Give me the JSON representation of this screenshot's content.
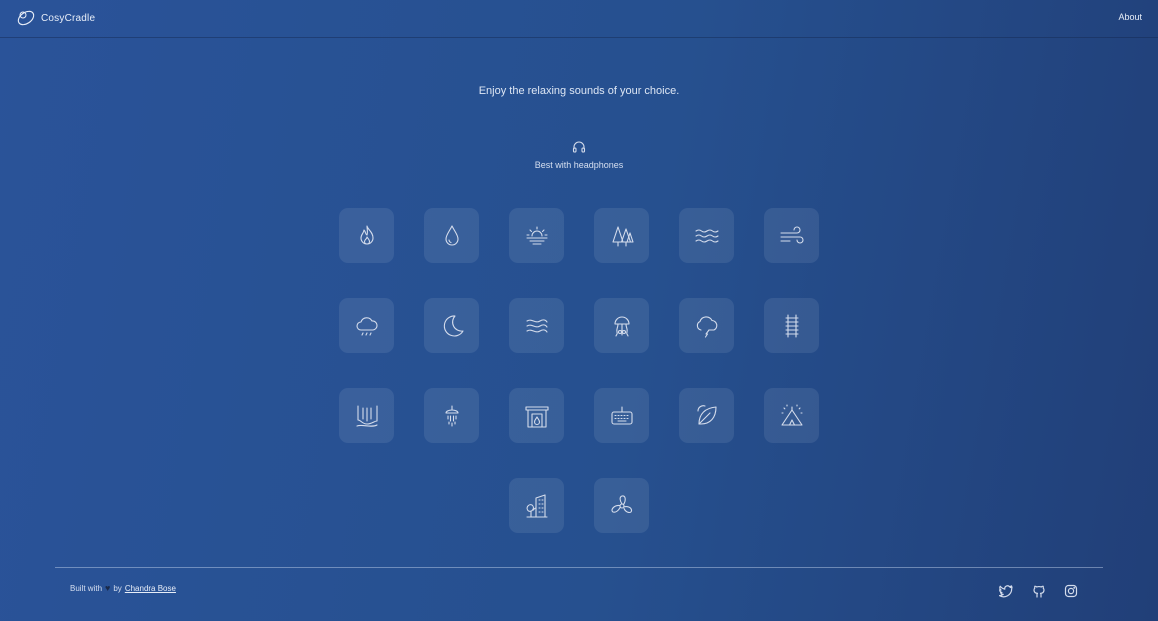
{
  "header": {
    "brand": "CosyCradle",
    "about_link": "About"
  },
  "main": {
    "tagline": "Enjoy the relaxing sounds of your choice.",
    "headphones_note": "Best with headphones"
  },
  "sounds": [
    {
      "icon": "fire-icon"
    },
    {
      "icon": "water-drop-icon"
    },
    {
      "icon": "sunset-icon"
    },
    {
      "icon": "forest-icon"
    },
    {
      "icon": "waves-icon"
    },
    {
      "icon": "wind-icon"
    },
    {
      "icon": "rain-cloud-icon"
    },
    {
      "icon": "moon-icon"
    },
    {
      "icon": "stream-icon"
    },
    {
      "icon": "jellyfish-icon"
    },
    {
      "icon": "thunder-cloud-icon"
    },
    {
      "icon": "train-track-icon"
    },
    {
      "icon": "waterfall-icon"
    },
    {
      "icon": "shower-icon"
    },
    {
      "icon": "fireplace-icon"
    },
    {
      "icon": "keyboard-icon"
    },
    {
      "icon": "leaf-icon"
    },
    {
      "icon": "camping-tent-icon"
    },
    {
      "icon": "city-icon"
    },
    {
      "icon": "fan-icon"
    }
  ],
  "footer": {
    "built_with": "Built with",
    "by": "by",
    "author": "Chandra Bose",
    "socials": [
      "twitter-icon",
      "github-icon",
      "instagram-icon"
    ]
  }
}
